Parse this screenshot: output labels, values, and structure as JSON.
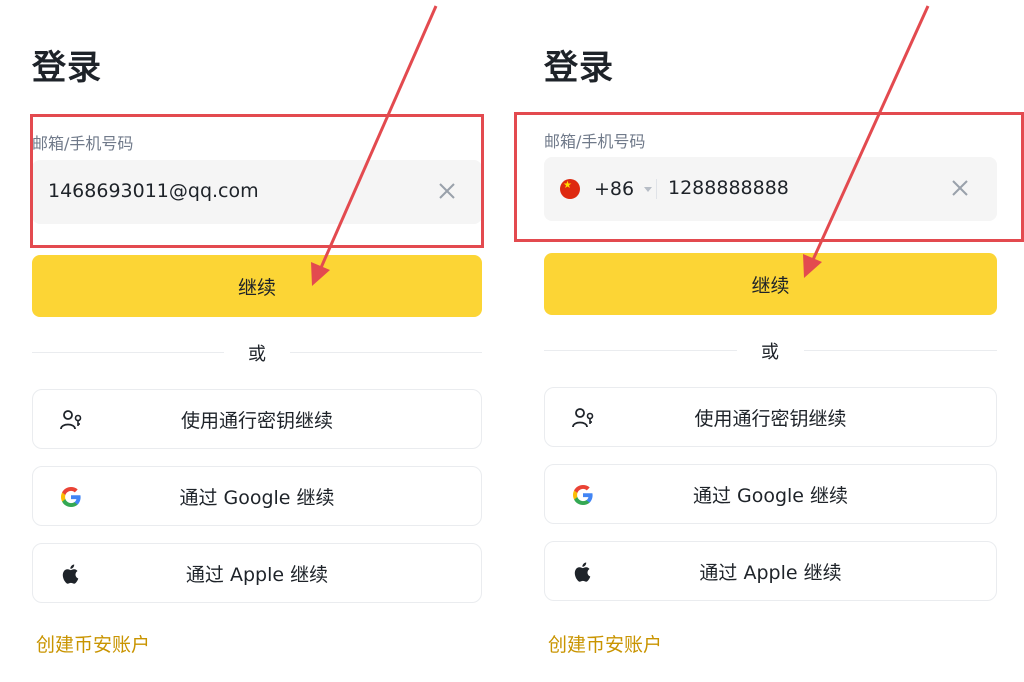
{
  "left": {
    "title": "登录",
    "field_label": "邮箱/手机号码",
    "input_value": "1468693011@qq.com",
    "continue_label": "继续",
    "divider_text": "或",
    "passkey_label": "使用通行密钥继续",
    "google_label": "通过 Google 继续",
    "apple_label": "通过 Apple 继续",
    "create_account": "创建币安账户"
  },
  "right": {
    "title": "登录",
    "field_label": "邮箱/手机号码",
    "country_code": "+86",
    "input_value": "1288888888",
    "continue_label": "继续",
    "divider_text": "或",
    "passkey_label": "使用通行密钥继续",
    "google_label": "通过 Google 继续",
    "apple_label": "通过 Apple 继续",
    "create_account": "创建币安账户"
  },
  "colors": {
    "accent": "#fcd535",
    "highlight": "#e34a4f",
    "link": "#c99400"
  },
  "icons": {
    "clear": "close-icon",
    "passkey": "passkey-user-icon",
    "google": "google-icon",
    "apple": "apple-icon",
    "flag": "china-flag-icon"
  }
}
